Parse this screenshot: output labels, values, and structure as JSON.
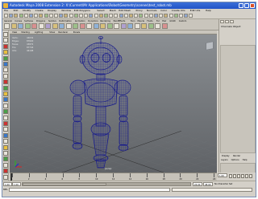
{
  "window": {
    "title": "Autodesk Maya 2008 Extension 2: X:\\Current\\Mr Applications\\Robot\\Geometry\\scenes\\test_robot.mb",
    "minimize_label": "_",
    "maximize_label": "□",
    "close_label": "×"
  },
  "menubar": [
    "File",
    "Edit",
    "Modify",
    "Create",
    "Display",
    "Window",
    "Edit Polygons",
    "Select",
    "Mesh",
    "Edit Mesh",
    "Proxy",
    "Normals",
    "Color",
    "Create UVs",
    "Edit UVs",
    "Help"
  ],
  "shelf": {
    "tabs": [
      "General",
      "Curves",
      "Surfaces",
      "Polygons",
      "Subdivs",
      "Deformation",
      "Animation",
      "Dynamics",
      "Rendering",
      "PaintEffects",
      "Toon",
      "Muscle",
      "Fluids",
      "Fur",
      "Hair",
      "nCloth",
      "Custom"
    ]
  },
  "viewport": {
    "menus": [
      "View",
      "Shading",
      "Lighting",
      "Show",
      "Renderer",
      "Panels"
    ],
    "hud": [
      {
        "label": "Verts:",
        "value": "44032"
      },
      {
        "label": "Edges:",
        "value": "87820"
      },
      {
        "label": "Faces:",
        "value": "43872"
      },
      {
        "label": "Tris:",
        "value": "87744"
      },
      {
        "label": "UVs:",
        "value": "46198"
      }
    ],
    "camera": "persp",
    "wire_color": "#1a1d8c"
  },
  "channel_box": {
    "title": "Channels  Object",
    "menus": [
      "Layers",
      "Options",
      "Help"
    ],
    "layer_tabs": [
      "Display",
      "Render"
    ]
  },
  "timeline": {
    "ticks": [
      "1",
      "2",
      "4",
      "6",
      "8",
      "10",
      "12",
      "14",
      "16",
      "18",
      "20",
      "22",
      "24"
    ],
    "current_frame": "1.00"
  },
  "range": {
    "start": "1.00",
    "start_inner": "1.00",
    "end_inner": "24.00",
    "end": "48.00",
    "anim_layer": "No Anim Layer",
    "char_set": "No Character Set"
  },
  "command_line": {
    "label": "MEL"
  },
  "help_line": ""
}
